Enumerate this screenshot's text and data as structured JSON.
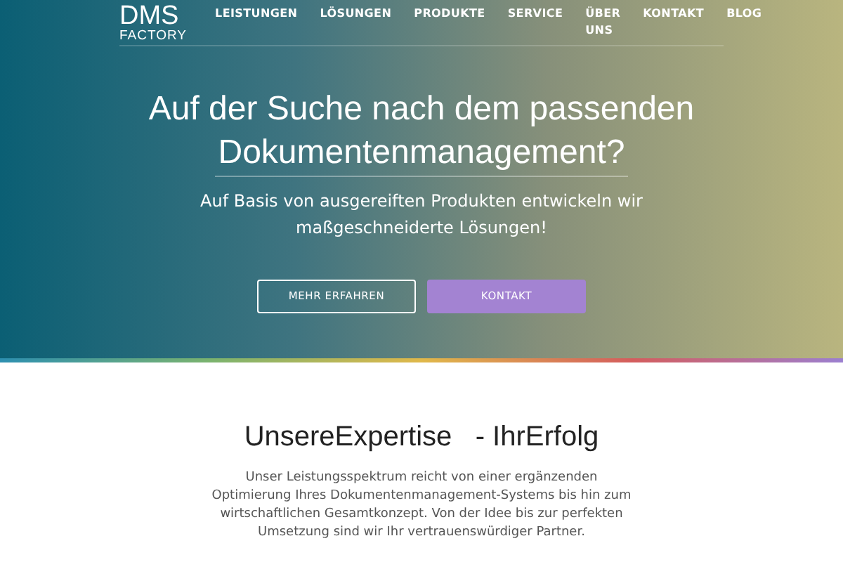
{
  "logo": {
    "line_1": "DMS",
    "line_2": "FACTORY"
  },
  "nav": [
    {
      "label": "LEISTUNGEN"
    },
    {
      "label": "LÖSUNGEN"
    },
    {
      "label": "PRODUKTE"
    },
    {
      "label": "SERVICE"
    },
    {
      "label": "ÜBER UNS"
    },
    {
      "label": "KONTAKT"
    },
    {
      "label": "BLOG"
    }
  ],
  "hero": {
    "title_line_1": "Auf der Suche nach dem passenden",
    "title_line_2": "Dokumentenmanagement?",
    "subtitle": "Auf Basis von ausgereiften Produkten entwickeln wir maßgeschneiderte Lösungen!",
    "buttons": [
      {
        "label": "MEHR ERFAHREN",
        "kind": "outline"
      },
      {
        "label": "KONTAKT",
        "kind": "filled"
      }
    ]
  },
  "expertise": {
    "title": "UnsereExpertise   - IhrErfolg",
    "text": "Unser Leistungsspektrum reicht von einer ergänzenden Optimierung Ihres Dokumentenmanagement-Systems bis hin zum wirtschaftlichen Gesamtkonzept. Von der Idee bis zur perfekten Umsetzung sind wir Ihr vertrauenswürdiger Partner."
  }
}
